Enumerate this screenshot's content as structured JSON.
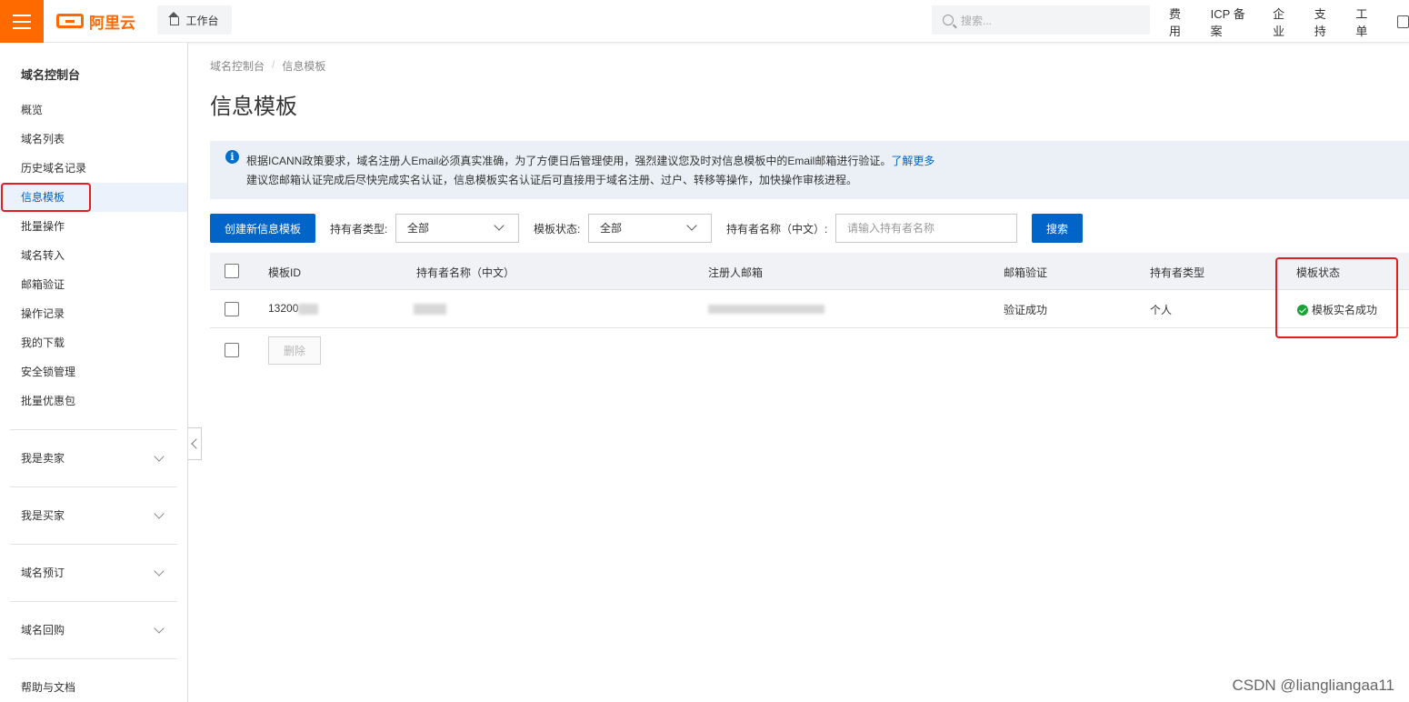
{
  "brand": {
    "logo_text": "阿里云",
    "accent": "#ff6a00",
    "primary": "#0064c8"
  },
  "topbar": {
    "workbench_label": "工作台",
    "search_placeholder": "搜索...",
    "nav": [
      "费用",
      "ICP 备案",
      "企业",
      "支持",
      "工单"
    ]
  },
  "sidebar": {
    "title": "域名控制台",
    "items": [
      "概览",
      "域名列表",
      "历史域名记录",
      "信息模板",
      "批量操作",
      "域名转入",
      "邮箱验证",
      "操作记录",
      "我的下载",
      "安全锁管理",
      "批量优惠包"
    ],
    "active_item": "信息模板",
    "groups": [
      "我是卖家",
      "我是买家",
      "域名预订",
      "域名回购"
    ],
    "footer": "帮助与文档"
  },
  "breadcrumb": [
    "域名控制台",
    "信息模板"
  ],
  "page_title": "信息模板",
  "notice": {
    "line1": "根据ICANN政策要求，域名注册人Email必须真实准确，为了方便日后管理使用，强烈建议您及时对信息模板中的Email邮箱进行验证。",
    "link": "了解更多",
    "line2": "建议您邮箱认证完成后尽快完成实名认证，信息模板实名认证后可直接用于域名注册、过户、转移等操作，加快操作审核进程。"
  },
  "toolbar": {
    "create_button": "创建新信息模板",
    "holder_type_label": "持有者类型:",
    "holder_type_value": "全部",
    "template_status_label": "模板状态:",
    "template_status_value": "全部",
    "holder_name_label": "持有者名称（中文）:",
    "holder_name_placeholder": "请输入持有者名称",
    "search_button": "搜索"
  },
  "table": {
    "headers": [
      "模板ID",
      "持有者名称（中文）",
      "注册人邮箱",
      "邮箱验证",
      "持有者类型",
      "模板状态"
    ],
    "rows": [
      {
        "template_id": "13200",
        "holder_name": "",
        "email": "",
        "email_verify": "验证成功",
        "holder_type": "个人",
        "status": "模板实名成功"
      }
    ],
    "delete_button": "删除"
  },
  "watermark": "CSDN @liangliangaa11"
}
